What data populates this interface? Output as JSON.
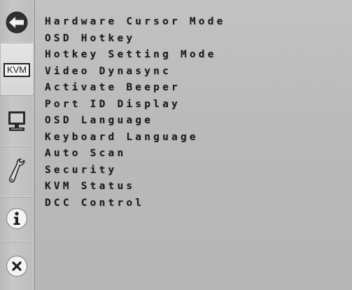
{
  "sidebar": {
    "kvm_label": "KVM",
    "buttons": [
      {
        "name": "back",
        "icon": "back-arrow-icon"
      },
      {
        "name": "kvm",
        "icon": "kvm-icon",
        "active": true
      },
      {
        "name": "monitor",
        "icon": "monitor-icon"
      },
      {
        "name": "tools",
        "icon": "wrench-icon"
      },
      {
        "name": "info",
        "icon": "info-icon"
      },
      {
        "name": "close",
        "icon": "close-icon"
      }
    ]
  },
  "menu": {
    "items": [
      "Hardware Cursor Mode",
      "OSD Hotkey",
      "Hotkey Setting Mode",
      "Video Dynasync",
      "Activate Beeper",
      "Port ID Display",
      "OSD Language",
      "Keyboard Language",
      "Auto Scan",
      "Security",
      "KVM Status",
      "DCC Control"
    ]
  },
  "colors": {
    "background": "#bdbdbd",
    "text": "#1c1c1c",
    "active_tab": "#dcdcdc"
  }
}
